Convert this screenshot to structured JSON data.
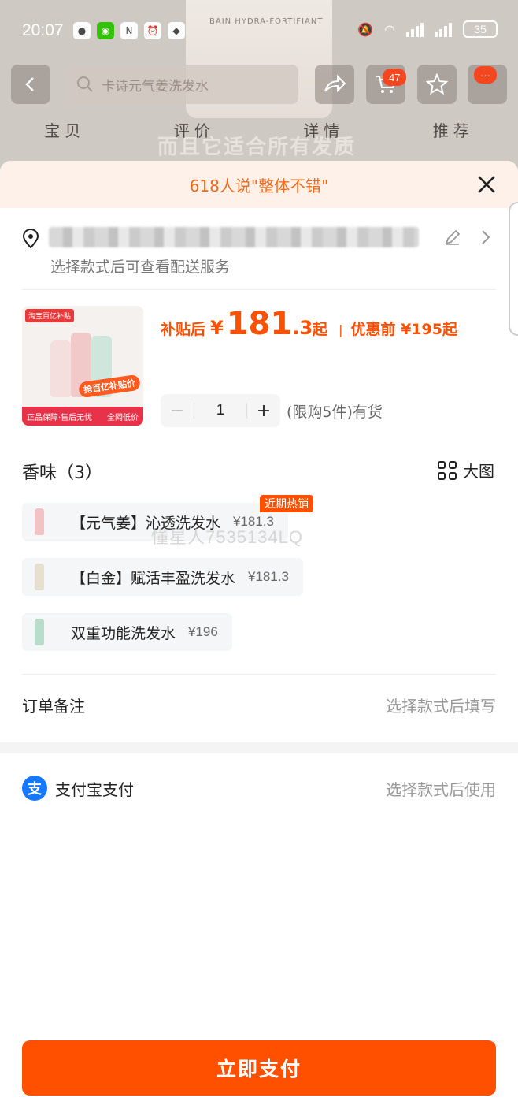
{
  "status_bar": {
    "time": "20:07",
    "battery": "35"
  },
  "background": {
    "search_placeholder": "卡诗元气姜洗发水",
    "cart_badge": "47",
    "more_badge": "···",
    "tabs": [
      "宝贝",
      "评价",
      "详情",
      "推荐"
    ],
    "slogan": "而且它适合所有发质",
    "bottle_text": "BAIN HYDRA-FORTIFIANT"
  },
  "sheet": {
    "header": "618人说\"整体不错\"",
    "address": {
      "subtext": "选择款式后可查看配送服务"
    },
    "product": {
      "thumb_tag": "淘宝百亿补贴",
      "thumb_promo": "抢百亿补贴价",
      "thumb_foot_left": "正品保障·售后无忧",
      "thumb_foot_right": "全网低价",
      "price_label": "补贴后",
      "currency": "¥",
      "price_int": "181",
      "price_dec": ".3",
      "price_suffix": "起",
      "orig_label": "优惠前 ¥195起",
      "quantity": "1",
      "stock_text": "(限购5件)有货"
    },
    "variant_section": {
      "title": "香味（3）",
      "big_view": "大图",
      "options": [
        {
          "name": "【元气姜】沁透洗发水",
          "price": "¥181.3",
          "color": "#f2c2c4",
          "badge": "近期热销"
        },
        {
          "name": "【白金】赋活丰盈洗发水",
          "price": "¥181.3",
          "color": "#e6e0cf"
        },
        {
          "name": "双重功能洗发水",
          "price": "¥196",
          "color": "#b9dccb"
        }
      ],
      "watermark": "懂星人7535134LQ"
    },
    "order_note": {
      "label": "订单备注",
      "hint": "选择款式后填写"
    },
    "payment": {
      "icon_char": "支",
      "label": "支付宝支付",
      "hint": "选择款式后使用"
    },
    "pay_button": "立即支付"
  },
  "colors": {
    "accent": "#ff5000",
    "header_bg": "#fdf1ea",
    "alipay": "#1677ff"
  }
}
